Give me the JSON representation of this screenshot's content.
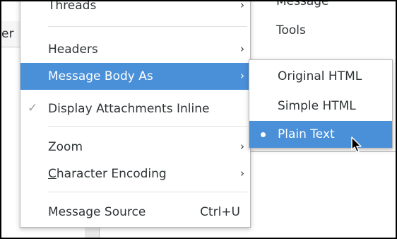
{
  "background": {
    "left_panel_text": "er"
  },
  "main_menu": {
    "items": [
      {
        "label": "Threads",
        "arrow": "›"
      },
      {
        "label": "Headers",
        "arrow": "›"
      },
      {
        "label": "Message Body As",
        "arrow": "›",
        "active": true
      },
      {
        "label": "Display Attachments Inline",
        "check": "✓"
      },
      {
        "label": "Zoom",
        "arrow": "›"
      },
      {
        "label_mnemonic": "C",
        "label_rest": "haracter Encoding",
        "arrow": "›"
      },
      {
        "label": "Message Source",
        "accel": "Ctrl+U"
      }
    ]
  },
  "top_menu": {
    "items": [
      {
        "label": "Message"
      },
      {
        "label": "Tools"
      }
    ]
  },
  "submenu": {
    "items": [
      {
        "label": "Original HTML"
      },
      {
        "label": "Simple HTML"
      },
      {
        "label": "Plain Text",
        "selected": true
      }
    ]
  },
  "colors": {
    "highlight": "#4a90d9",
    "text": "#2e3436",
    "border": "#b8b8b8"
  },
  "icons": {
    "checkmark": "check-icon",
    "submenu_arrow": "chevron-right-icon",
    "radio_bullet": "radio-dot-icon",
    "cursor": "mouse-pointer-icon"
  }
}
